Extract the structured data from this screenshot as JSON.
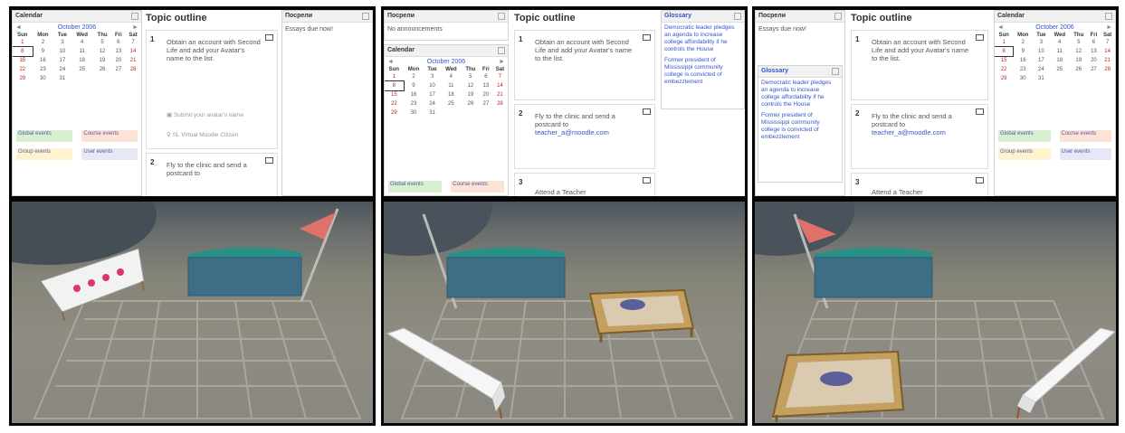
{
  "frames": {
    "f1": {
      "calendar": {
        "title": "Calendar",
        "month": "October 2006",
        "prev": "◄",
        "next": "►",
        "weekdays": [
          "Sun",
          "Mon",
          "Tue",
          "Wed",
          "Thu",
          "Fri",
          "Sat"
        ],
        "weeks": [
          [
            "1",
            "2",
            "3",
            "4",
            "5",
            "6",
            "7"
          ],
          [
            "8",
            "9",
            "10",
            "11",
            "12",
            "13",
            "14"
          ],
          [
            "15",
            "16",
            "17",
            "18",
            "19",
            "20",
            "21"
          ],
          [
            "22",
            "23",
            "24",
            "25",
            "26",
            "27",
            "28"
          ],
          [
            "29",
            "30",
            "31",
            "",
            "",
            "",
            ""
          ]
        ],
        "legend": {
          "global": "Global events",
          "course": "Course events",
          "group": "Group events",
          "user": "User events"
        }
      },
      "topic": {
        "title": "Topic outline",
        "sections": [
          {
            "num": "1",
            "text": "Obtain an account with Second Life and add your Avatar's name to the list.",
            "sub1": "Submit your avatar's name",
            "sub2": "SL Virtual Moodle Citizen"
          },
          {
            "num": "2",
            "text": "Fly to the clinic and send a postcard to"
          }
        ]
      },
      "right": {
        "title": "Посрели",
        "text": "Essays due now!"
      }
    },
    "f2": {
      "left": {
        "title": "Посрели",
        "text": "No announcements"
      },
      "calendar": {
        "title": "Calendar",
        "month": "October 2006",
        "prev": "◄",
        "next": "►",
        "weekdays": [
          "Sun",
          "Mon",
          "Tue",
          "Wed",
          "Thu",
          "Fri",
          "Sat"
        ],
        "weeks": [
          [
            "1",
            "2",
            "3",
            "4",
            "5",
            "6",
            "7"
          ],
          [
            "8",
            "9",
            "10",
            "11",
            "12",
            "13",
            "14"
          ],
          [
            "15",
            "16",
            "17",
            "18",
            "19",
            "20",
            "21"
          ],
          [
            "22",
            "23",
            "24",
            "25",
            "26",
            "27",
            "28"
          ],
          [
            "29",
            "30",
            "31",
            "",
            "",
            "",
            ""
          ]
        ],
        "legend": {
          "global": "Global events",
          "course": "Course events"
        }
      },
      "topic": {
        "title": "Topic outline",
        "sections": [
          {
            "num": "1",
            "text": "Obtain an account with Second Life and add your Avatar's name to the list."
          },
          {
            "num": "2",
            "text": "Fly to the clinic and send a postcard to",
            "link": "teacher_a@moodle.com"
          },
          {
            "num": "3",
            "text": "Attend a Teacher"
          }
        ]
      },
      "right": {
        "title": "Glossary",
        "items": [
          "Democratic leader pledges an agenda to increase college affordability if he controls the House",
          "Former president of Mississippi community college is convicted of embezzlement"
        ]
      }
    },
    "f3": {
      "left": {
        "title": "Посрели",
        "text": "Essays due now!",
        "glossary_title": "Glossary",
        "items": [
          "Democratic leader pledges an agenda to increase college affordability if he controls the House",
          "Former president of Mississippi community college is convicted of embezzlement"
        ]
      },
      "topic": {
        "title": "Topic outline",
        "sections": [
          {
            "num": "1",
            "text": "Obtain an account with Second Life and add your Avatar's name to the list."
          },
          {
            "num": "2",
            "text": "Fly to the clinic and send a postcard to",
            "link": "teacher_a@moodle.com"
          },
          {
            "num": "3",
            "text": "Attend a Teacher"
          }
        ]
      },
      "calendar": {
        "title": "Calendar",
        "month": "October 2006",
        "prev": "◄",
        "next": "►",
        "weekdays": [
          "Sun",
          "Mon",
          "Tue",
          "Wed",
          "Thu",
          "Fri",
          "Sat"
        ],
        "weeks": [
          [
            "1",
            "2",
            "3",
            "4",
            "5",
            "6",
            "7"
          ],
          [
            "8",
            "9",
            "10",
            "11",
            "12",
            "13",
            "14"
          ],
          [
            "15",
            "16",
            "17",
            "18",
            "19",
            "20",
            "21"
          ],
          [
            "22",
            "23",
            "24",
            "25",
            "26",
            "27",
            "28"
          ],
          [
            "29",
            "30",
            "31",
            "",
            "",
            "",
            ""
          ]
        ],
        "legend": {
          "global": "Global events",
          "course": "Course events",
          "group": "Group events",
          "user": "User events"
        }
      }
    }
  },
  "colors": {
    "link": "#3355cc",
    "weekend": "#b22222",
    "frame": "#050505",
    "board": "#3e6e86",
    "flag": "#e0706a",
    "grid": "#a8a49c"
  }
}
